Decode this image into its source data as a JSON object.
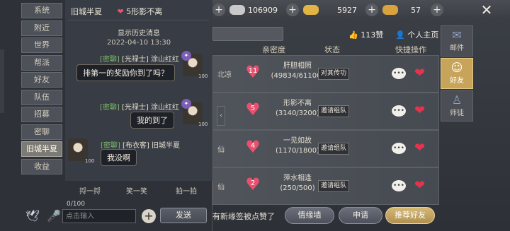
{
  "topbar": {
    "currencies": [
      {
        "icon": "silver-ingot-icon",
        "value": "106909",
        "color": "#c9c9c9"
      },
      {
        "icon": "gold-ingot-icon",
        "value": "5927",
        "color": "#e2b443"
      },
      {
        "icon": "gold-ingot-icon",
        "value": "57",
        "color": "#d8a23c"
      }
    ]
  },
  "friends": {
    "likes": "113赞",
    "home": "个人主页",
    "headers": {
      "relation": "亲密度",
      "status": "状态",
      "ops": "快捷操作"
    },
    "rows": [
      {
        "loc": "北凉",
        "level": "11",
        "rel_title": "肝胆相照",
        "rel_value": "(49834/61100)",
        "status": "对其传功"
      },
      {
        "loc": "仙",
        "level": "5",
        "rel_title": "形影不离",
        "rel_value": "(3140/3200)",
        "status": "邀请组队"
      },
      {
        "loc": "仙",
        "level": "4",
        "rel_title": "一见如故",
        "rel_value": "(1170/1800)",
        "status": "邀请组队"
      },
      {
        "loc": "仙",
        "level": "2",
        "rel_title": "萍水相逢",
        "rel_value": "(250/500)",
        "status": "邀请组队"
      }
    ],
    "side_tabs": [
      {
        "label": "邮件",
        "icon": "mail-icon"
      },
      {
        "label": "好友",
        "icon": "friend-icon"
      },
      {
        "label": "师徒",
        "icon": "mentor-icon"
      }
    ],
    "bottom": {
      "ticker": "有新缘签被点赞了",
      "fate_wall": "情缘墙",
      "apply": "申请",
      "recommend": "推荐好友"
    }
  },
  "chat": {
    "channels": [
      "系统",
      "附近",
      "世界",
      "帮派",
      "好友",
      "队伍",
      "招募",
      "密聊",
      "旧城半夏",
      "收益"
    ],
    "active_channel": "旧城半夏",
    "header": {
      "name": "旧城半夏",
      "heart": "❤",
      "relation": "5形影不离"
    },
    "history_label": "显示历史消息",
    "history_time": "2022-04-10 13:30",
    "messages": [
      {
        "channel": "[密聊]",
        "sender": "[光禄士] 涂山红红",
        "text": "排第一的奖励你到了吗？",
        "level": "100"
      },
      {
        "channel": "[密聊]",
        "sender": "[光禄士] 涂山红红",
        "text": "我的到了",
        "level": "100"
      },
      {
        "channel": "[密聊]",
        "sender": "[布衣客] 旧城半夏",
        "text": "我没啊",
        "level": "100"
      }
    ],
    "actions": [
      "捋一捋",
      "笑一笑",
      "拍一拍"
    ],
    "counter": "0/100",
    "input_placeholder": "点击输入",
    "send_label": "发送"
  }
}
